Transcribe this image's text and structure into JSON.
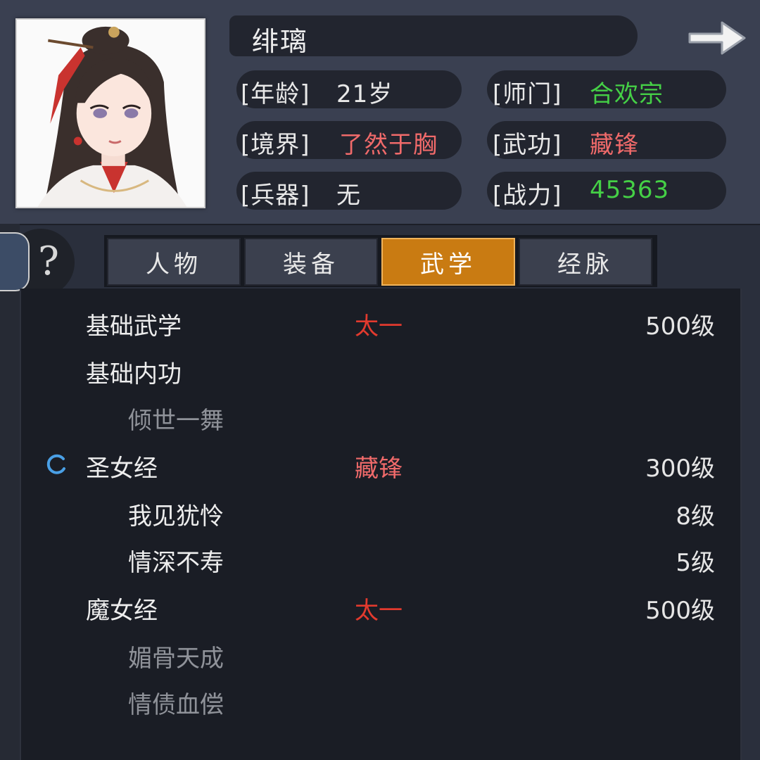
{
  "character": {
    "name": "绯璃",
    "stats": {
      "age_label": "[年龄]",
      "age_value": "21岁",
      "sect_label": "[师门]",
      "sect_value": "合欢宗",
      "realm_label": "[境界]",
      "realm_value": "了然于胸",
      "skill_label": "[武功]",
      "skill_value": "藏锋",
      "weapon_label": "[兵器]",
      "weapon_value": "无",
      "power_label": "[战力]",
      "power_value": "45363"
    }
  },
  "help": {
    "icon": "question-icon",
    "text": "?"
  },
  "tabs": [
    {
      "label": "人物",
      "active": false
    },
    {
      "label": "装备",
      "active": false
    },
    {
      "label": "武学",
      "active": true
    },
    {
      "label": "经脉",
      "active": false
    }
  ],
  "martial_list": [
    {
      "name": "基础武学",
      "tag": "太一",
      "level": "500级",
      "indent": false,
      "dim": false
    },
    {
      "name": "基础内功",
      "tag": "",
      "level": "",
      "indent": false,
      "dim": false
    },
    {
      "name": "倾世一舞",
      "tag": "",
      "level": "",
      "indent": true,
      "dim": true
    },
    {
      "name": "圣女经",
      "tag": "藏锋",
      "level": "300级",
      "indent": false,
      "dim": false,
      "loading": true
    },
    {
      "name": "我见犹怜",
      "tag": "",
      "level": "8级",
      "indent": true,
      "dim": false
    },
    {
      "name": "情深不寿",
      "tag": "",
      "level": "5级",
      "indent": true,
      "dim": false
    },
    {
      "name": "魔女经",
      "tag": "太一",
      "level": "500级",
      "indent": false,
      "dim": false
    },
    {
      "name": "媚骨天成",
      "tag": "",
      "level": "",
      "indent": true,
      "dim": true
    },
    {
      "name": "情债血偿",
      "tag": "",
      "level": "",
      "indent": true,
      "dim": true
    }
  ],
  "colors": {
    "green": "#45d046",
    "red_value": "#f06a6a",
    "red_tag": "#e23a2e",
    "active_tab": "#c97b12"
  }
}
